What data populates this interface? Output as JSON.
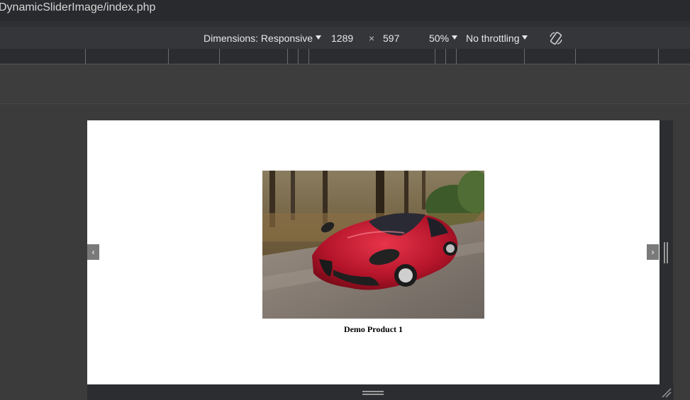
{
  "url": {
    "path": "DynamicSliderImage/index.php"
  },
  "devtools_toolbar": {
    "dimensions_label": "Dimensions: Responsive",
    "width_value": "1289",
    "times_symbol": "×",
    "height_value": "597",
    "zoom_value": "50%",
    "throttling_value": "No throttling",
    "rotate_icon": "rotate-icon"
  },
  "slider": {
    "prev_symbol": "‹",
    "next_symbol": "›",
    "caption": "Demo Product 1",
    "image_subject": "red sports car on road"
  },
  "colors": {
    "page_bg": "#3b3b3b",
    "toolbar_bg": "#35363a",
    "viewport_bg": "#ffffff",
    "car_red": "#c0182a"
  }
}
